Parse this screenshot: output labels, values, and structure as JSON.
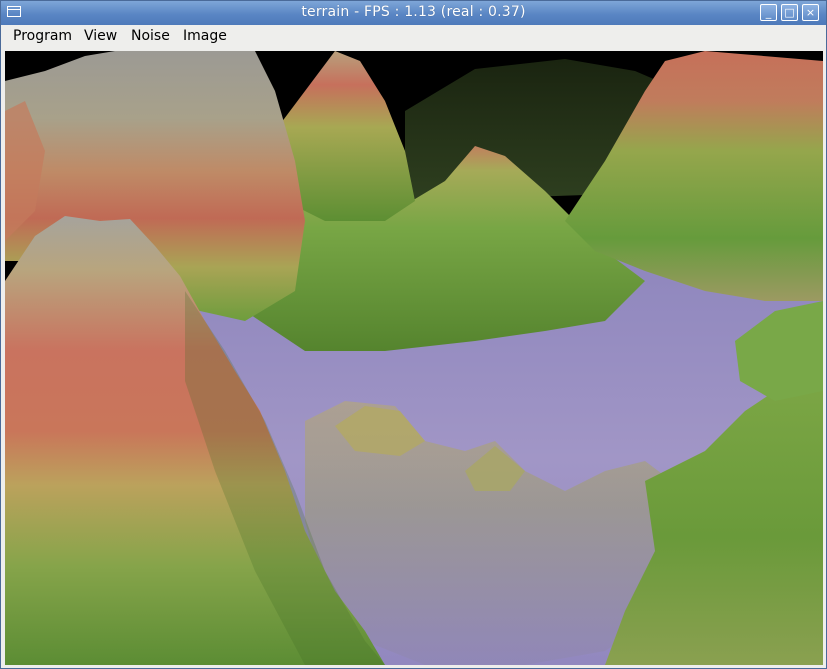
{
  "window": {
    "title": "terrain - FPS : 1.13 (real : 0.37)"
  },
  "controls": {
    "minimize_glyph": "_",
    "maximize_glyph": "□",
    "close_glyph": "×"
  },
  "menu": {
    "items": [
      {
        "label": "Program"
      },
      {
        "label": "View"
      },
      {
        "label": "Noise"
      },
      {
        "label": "Image"
      }
    ]
  },
  "icons": {
    "window_menu": "window-menu-icon",
    "minimize": "minimize-icon",
    "maximize": "maximize-icon",
    "close": "close-icon"
  },
  "colors": {
    "titlebar": "#5a86c4",
    "water": "#9a8fc0",
    "grass": "#6a9a3a",
    "sand": "#c2ad62",
    "rock_red": "#c0685a",
    "snow": "#a6a39c",
    "sky": "#000000"
  }
}
